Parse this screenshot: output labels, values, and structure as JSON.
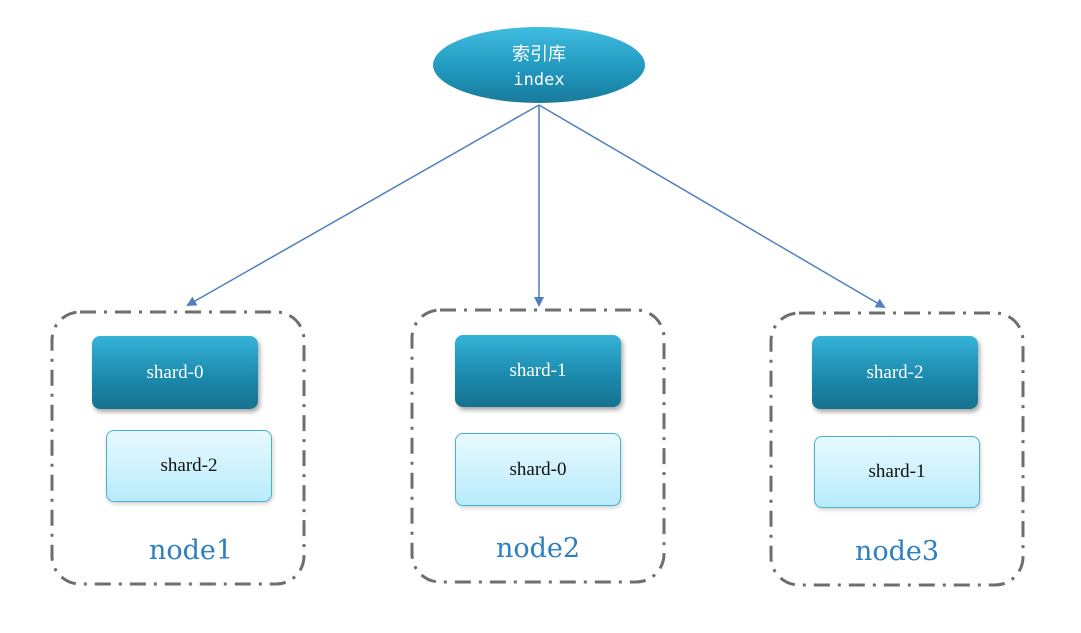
{
  "index": {
    "title": "索引库",
    "subtitle": "index"
  },
  "nodes": [
    {
      "label": "node1",
      "primary": "shard-0",
      "replica": "shard-2"
    },
    {
      "label": "node2",
      "primary": "shard-1",
      "replica": "shard-0"
    },
    {
      "label": "node3",
      "primary": "shard-2",
      "replica": "shard-1"
    }
  ],
  "colors": {
    "primary_shard": "#1c8bae",
    "replica_shard": "#c6f0fc",
    "arrow": "#4f7fc1",
    "node_border": "#6e6e6e",
    "node_label": "#2d7fc1"
  }
}
